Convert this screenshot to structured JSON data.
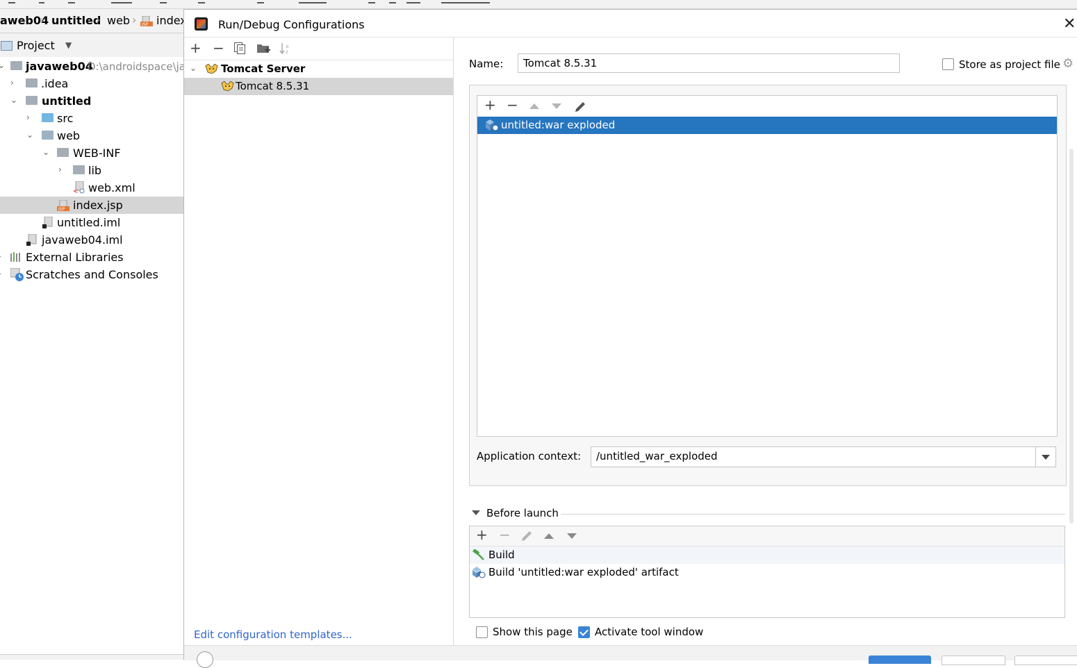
{
  "breadcrumb": {
    "items": [
      "aweb04",
      "untitled",
      "web",
      "index"
    ]
  },
  "project_panel": {
    "title": "Project",
    "tree": [
      {
        "label": "javaweb04",
        "path": "D:\\androidspace\\ja",
        "bold": true,
        "icon": "module-folder-icon"
      },
      {
        "label": ".idea",
        "icon": "folder-icon"
      },
      {
        "label": "untitled",
        "bold": true,
        "icon": "module-folder-icon"
      },
      {
        "label": "src",
        "icon": "source-folder-icon"
      },
      {
        "label": "web",
        "icon": "web-folder-icon"
      },
      {
        "label": "WEB-INF",
        "icon": "folder-icon"
      },
      {
        "label": "lib",
        "icon": "folder-icon"
      },
      {
        "label": "web.xml",
        "icon": "xml-file-icon"
      },
      {
        "label": "index.jsp",
        "icon": "jsp-file-icon",
        "selected": true
      },
      {
        "label": "untitled.iml",
        "icon": "iml-file-icon"
      },
      {
        "label": "javaweb04.iml",
        "icon": "iml-file-icon"
      },
      {
        "label": "External Libraries",
        "icon": "libraries-icon"
      },
      {
        "label": "Scratches and Consoles",
        "icon": "scratches-icon"
      }
    ]
  },
  "dialog": {
    "title": "Run/Debug Configurations",
    "config_tree": {
      "group": "Tomcat Server",
      "item": "Tomcat 8.5.31"
    },
    "edit_templates_link": "Edit configuration templates...",
    "name_label": "Name:",
    "name_value": "Tomcat 8.5.31",
    "store_as_project_file": "Store as project file",
    "deployment": {
      "items": [
        "untitled:war exploded"
      ],
      "app_context_label": "Application context:",
      "app_context_value": "/untitled_war_exploded"
    },
    "before_launch": {
      "title": "Before launch",
      "items": [
        "Build",
        "Build 'untitled:war exploded' artifact"
      ]
    },
    "show_this_page": "Show this page",
    "activate_tool_window": "Activate tool window"
  },
  "colors": {
    "selection_blue": "#2675bf",
    "link_blue": "#2f65ca",
    "checkbox_blue": "#3a84d6"
  }
}
